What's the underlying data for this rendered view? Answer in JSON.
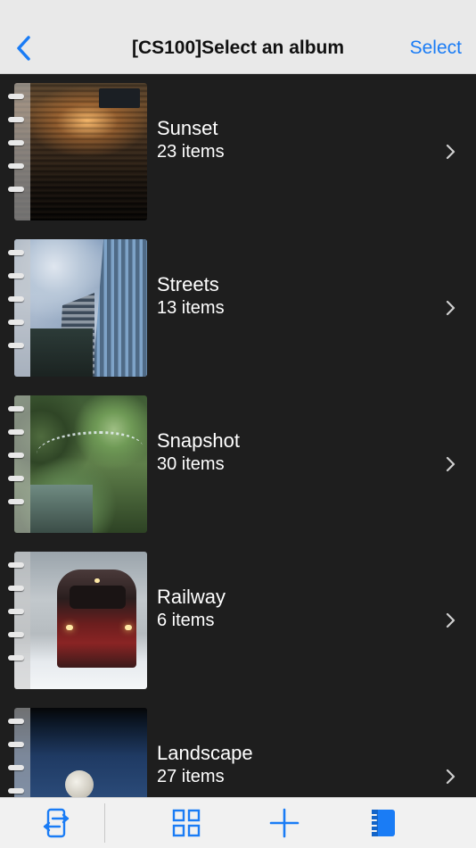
{
  "header": {
    "title": "[CS100]Select an album",
    "select_label": "Select",
    "back_icon": "chevron-left-icon"
  },
  "albums": [
    {
      "name": "Sunset",
      "count": "23 items",
      "thumb": "sunset-over-water"
    },
    {
      "name": "Streets",
      "count": "13 items",
      "thumb": "skyscrapers-and-clouds"
    },
    {
      "name": "Snapshot",
      "count": "30 items",
      "thumb": "fountain-water-spray"
    },
    {
      "name": "Railway",
      "count": "6 items",
      "thumb": "red-train-in-snow"
    },
    {
      "name": "Landscape",
      "count": "27 items",
      "thumb": "moon-in-blue-sky"
    }
  ],
  "toolbar": {
    "items": [
      "transfer-icon",
      "grid-icon",
      "plus-icon",
      "album-icon"
    ]
  },
  "colors": {
    "accent": "#1a7cf5",
    "background": "#1e1e1e",
    "header_bg": "#e9e9e9",
    "toolbar_bg": "#f1f1f1"
  }
}
